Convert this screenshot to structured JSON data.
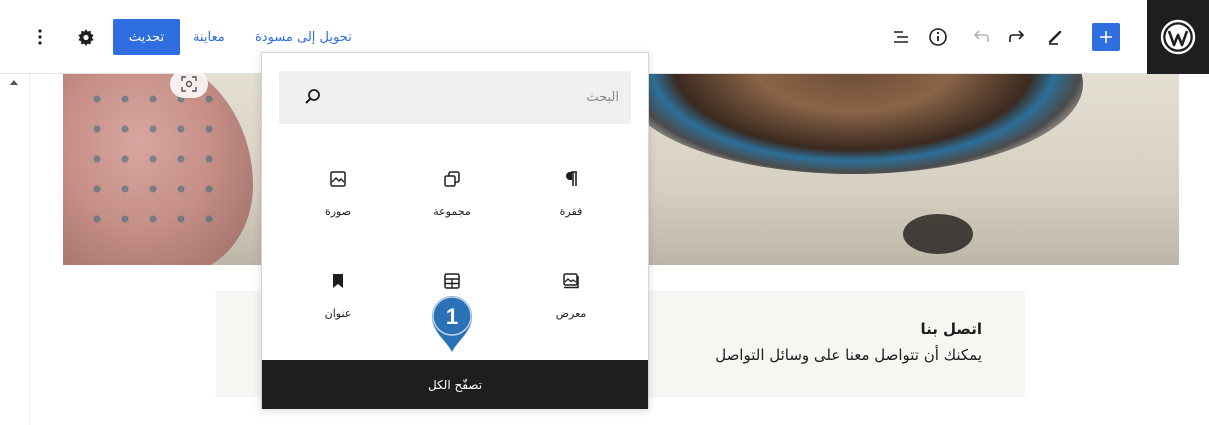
{
  "toolbar": {
    "convert_to_draft": "تحويل إلى مسودة",
    "preview": "معاينة",
    "update": "تحديث",
    "icons": [
      "more-vertical-icon",
      "gear-icon",
      "list-view-icon",
      "info-icon",
      "undo-icon",
      "redo-icon",
      "pencil-icon",
      "plus-icon",
      "wordpress-logo"
    ]
  },
  "inserter": {
    "search_placeholder": "البحث",
    "blocks": [
      {
        "label": "فقرة",
        "icon": "paragraph-icon"
      },
      {
        "label": "مجموعة",
        "icon": "group-icon"
      },
      {
        "label": "صورة",
        "icon": "image-icon"
      },
      {
        "label": "معرض",
        "icon": "gallery-icon"
      },
      {
        "label": "",
        "icon": "table-icon"
      },
      {
        "label": "عنوان",
        "icon": "heading-icon"
      }
    ],
    "browse_all": "تصفّح الكل"
  },
  "content": {
    "contact_title": "اتصل بنا",
    "contact_text": "يمكنك أن تتواصل معنا على وسائل التواصل"
  },
  "callout": {
    "number": "1"
  },
  "colors": {
    "accent": "#2f6ee0",
    "dark": "#1e1e1e",
    "callout": "#2a72b5"
  }
}
